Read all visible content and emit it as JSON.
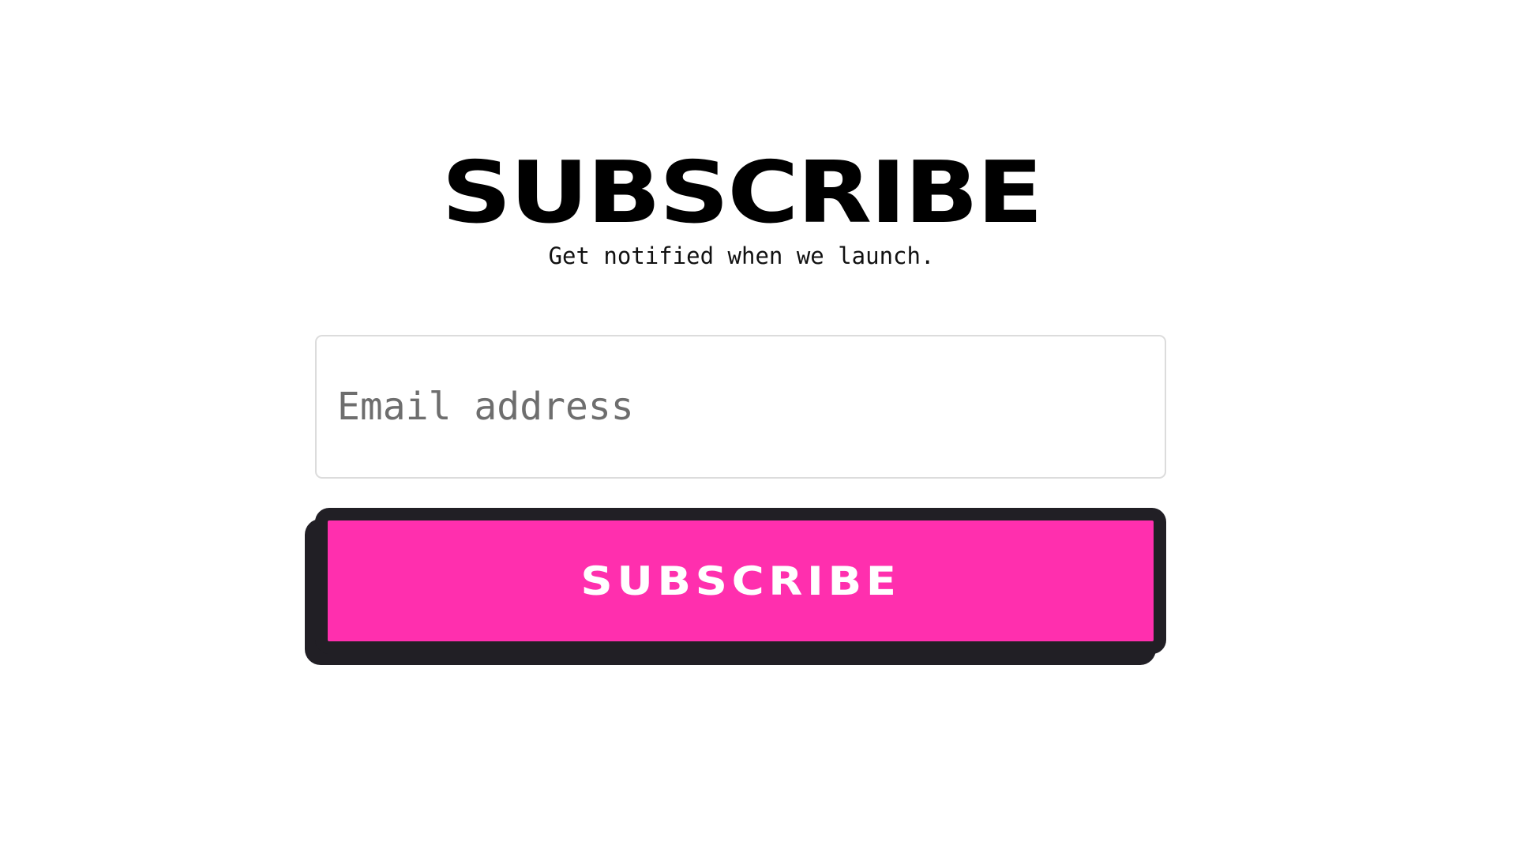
{
  "header": {
    "title": "SUBSCRIBE",
    "subtitle": "Get notified when we launch."
  },
  "form": {
    "email_placeholder": "Email address",
    "email_value": "",
    "submit_label": "SUBSCRIBE"
  },
  "colors": {
    "background": "#ffffff",
    "title": "#000000",
    "accent": "#ff2fae",
    "button_outline": "#211f25",
    "placeholder": "#6e6e6e",
    "input_border": "#dcdcdc"
  }
}
